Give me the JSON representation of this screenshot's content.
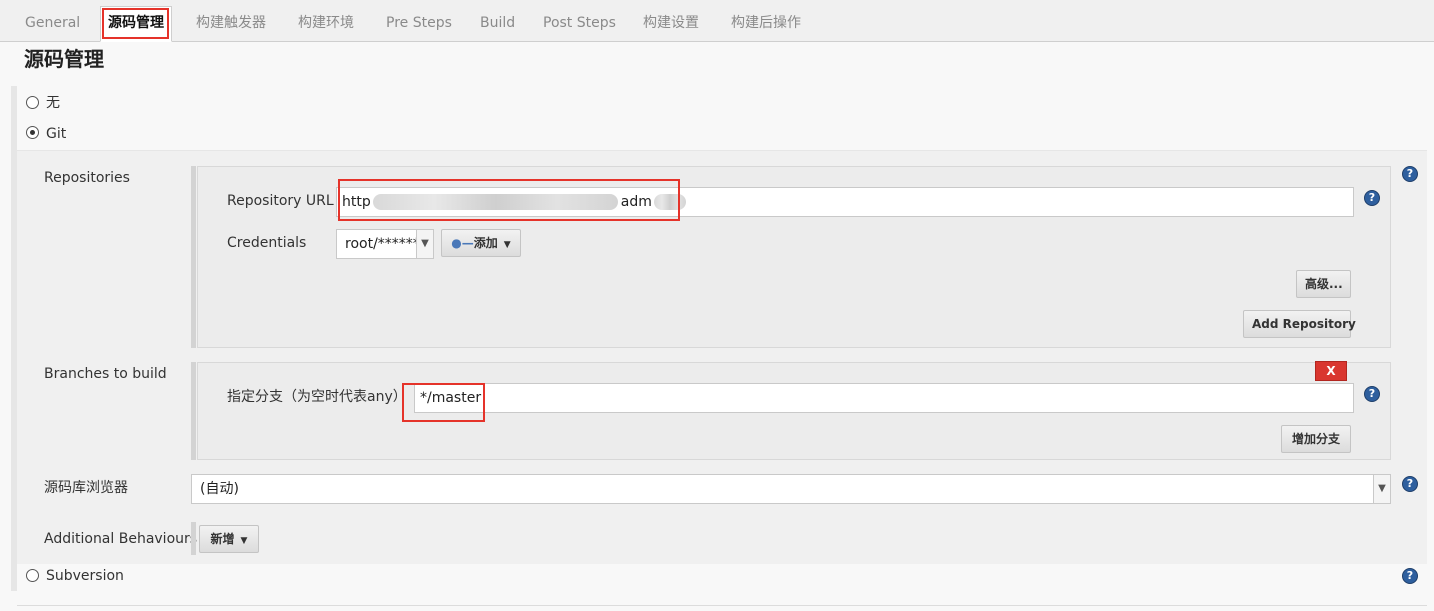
{
  "tabs": [
    {
      "label": "General"
    },
    {
      "label": "源码管理",
      "active": true
    },
    {
      "label": "构建触发器"
    },
    {
      "label": "构建环境"
    },
    {
      "label": "Pre Steps"
    },
    {
      "label": "Build"
    },
    {
      "label": "Post Steps"
    },
    {
      "label": "构建设置"
    },
    {
      "label": "构建后操作"
    }
  ],
  "section_title": "源码管理",
  "scm_options": [
    {
      "label": "无",
      "checked": false
    },
    {
      "label": "Git",
      "checked": true
    },
    {
      "label": "Subversion",
      "checked": false
    }
  ],
  "git": {
    "repositories_label": "Repositories",
    "repo_url_label": "Repository URL",
    "repo_url_prefix": "http",
    "repo_url_suffix": "adm",
    "credentials_label": "Credentials",
    "credentials_value": "root/******",
    "add_label": "添加",
    "advanced_label": "高级...",
    "add_repository_label": "Add Repository",
    "branches_label": "Branches to build",
    "branch_spec_label": "指定分支（为空时代表any）",
    "branch_value": "*/master",
    "delete_label": "X",
    "add_branch_label": "增加分支",
    "browser_label": "源码库浏览器",
    "browser_value": "(自动)",
    "additional_label": "Additional Behaviours",
    "new_label": "新增"
  },
  "help_glyph": "?",
  "colors": {
    "highlight": "#e5332a",
    "help": "#2e5f9e",
    "delete": "#d9362f"
  }
}
